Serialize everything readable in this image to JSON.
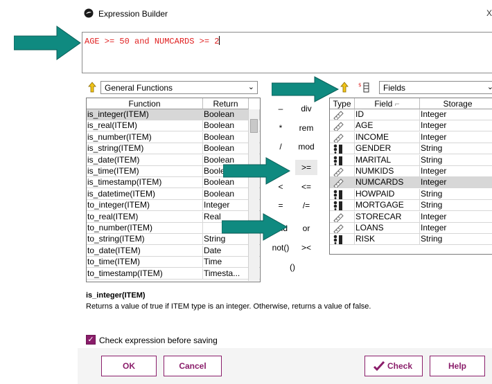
{
  "window": {
    "title": "Expression Builder",
    "close_glyph": "X"
  },
  "expression": {
    "text": "AGE >= 50 and NUMCARDS >= 2"
  },
  "functions_dropdown": {
    "selected": "General Functions"
  },
  "fields_dropdown": {
    "selected": "Fields"
  },
  "functions_table": {
    "headers": [
      "Function",
      "Return"
    ],
    "rows": [
      {
        "fn": "is_integer(ITEM)",
        "ret": "Boolean"
      },
      {
        "fn": "is_real(ITEM)",
        "ret": "Boolean"
      },
      {
        "fn": "is_number(ITEM)",
        "ret": "Boolean"
      },
      {
        "fn": "is_string(ITEM)",
        "ret": "Boolean"
      },
      {
        "fn": "is_date(ITEM)",
        "ret": "Boolean"
      },
      {
        "fn": "is_time(ITEM)",
        "ret": "Boole"
      },
      {
        "fn": "is_timestamp(ITEM)",
        "ret": "Boolean"
      },
      {
        "fn": "is_datetime(ITEM)",
        "ret": "Boolean"
      },
      {
        "fn": "to_integer(ITEM)",
        "ret": "Integer"
      },
      {
        "fn": "to_real(ITEM)",
        "ret": "Real"
      },
      {
        "fn": "to_number(ITEM)",
        "ret": ""
      },
      {
        "fn": "to_string(ITEM)",
        "ret": "String"
      },
      {
        "fn": "to_date(ITEM)",
        "ret": "Date"
      },
      {
        "fn": "to_time(ITEM)",
        "ret": "Time"
      },
      {
        "fn": "to_timestamp(ITEM)",
        "ret": "Timesta..."
      }
    ]
  },
  "operators": [
    {
      "left": "–",
      "right": "div"
    },
    {
      "left": "*",
      "right": "rem"
    },
    {
      "left": "/",
      "right": "mod"
    },
    {
      "left": "",
      "right": ">="
    },
    {
      "left": "<",
      "right": "<="
    },
    {
      "left": "=",
      "right": "/="
    },
    {
      "left": "and",
      "right": "or"
    },
    {
      "left": "not()",
      "right": "><"
    },
    {
      "left": "()",
      "right": ""
    }
  ],
  "fields_table": {
    "headers": [
      "Type",
      "Field",
      "Storage"
    ],
    "rows": [
      {
        "type": "continuous",
        "field": "ID",
        "storage": "Integer"
      },
      {
        "type": "continuous",
        "field": "AGE",
        "storage": "Integer"
      },
      {
        "type": "continuous",
        "field": "INCOME",
        "storage": "Integer"
      },
      {
        "type": "categorical",
        "field": "GENDER",
        "storage": "String"
      },
      {
        "type": "categorical",
        "field": "MARITAL",
        "storage": "String"
      },
      {
        "type": "continuous",
        "field": "NUMKIDS",
        "storage": "Integer"
      },
      {
        "type": "continuous",
        "field": "NUMCARDS",
        "storage": "Integer"
      },
      {
        "type": "categorical",
        "field": "HOWPAID",
        "storage": "String"
      },
      {
        "type": "categorical",
        "field": "MORTGAGE",
        "storage": "String"
      },
      {
        "type": "continuous",
        "field": "STORECAR",
        "storage": "Integer"
      },
      {
        "type": "continuous",
        "field": "LOANS",
        "storage": "Integer"
      },
      {
        "type": "categorical",
        "field": "RISK",
        "storage": "String"
      }
    ]
  },
  "description": {
    "title": "is_integer(ITEM)",
    "text": "Returns a value of true if ITEM type is an integer. Otherwise, returns a value of false."
  },
  "check_option": {
    "label": "Check expression before saving",
    "checked": true
  },
  "buttons": {
    "ok": "OK",
    "cancel": "Cancel",
    "check": "Check",
    "help": "Help"
  },
  "colors": {
    "annotation_arrow": "#0f8a80",
    "accent": "#8a1d6a",
    "expression_text": "#e02020"
  }
}
